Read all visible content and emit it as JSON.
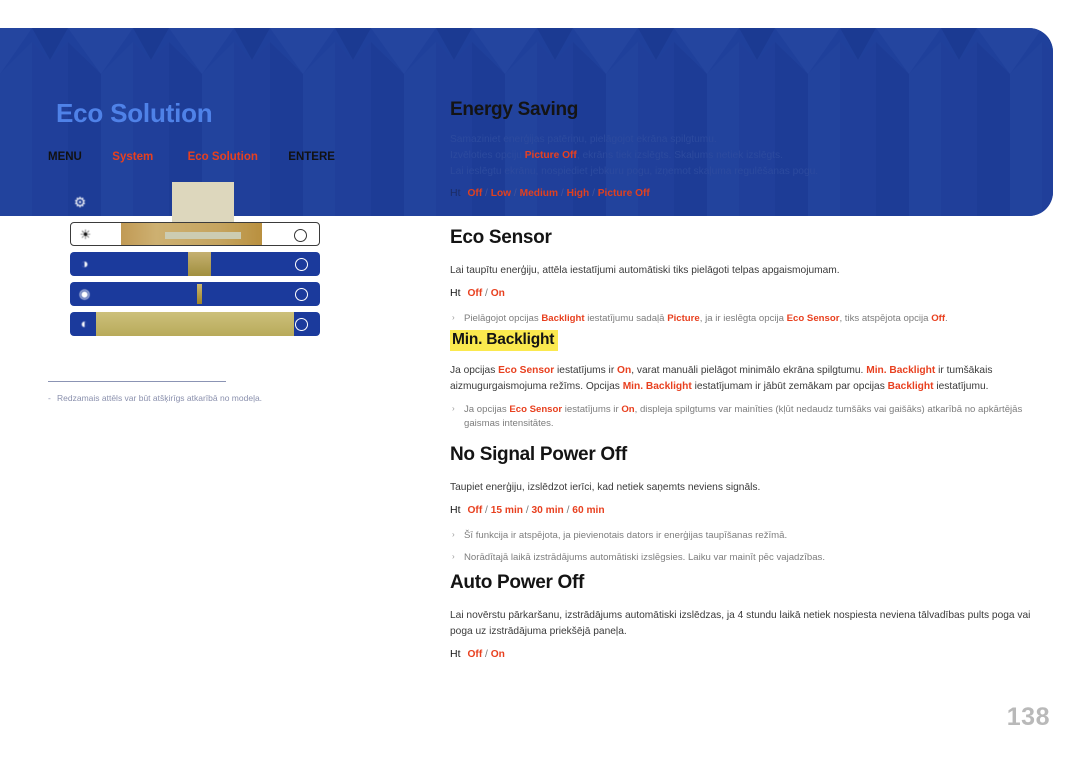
{
  "page": {
    "title": "Eco Solution",
    "number": "138",
    "accent_red": "#e8401f",
    "banner_blue": "#1f409b",
    "title_blue": "#4f82e8",
    "highlight_yellow": "#fbe94e"
  },
  "breadcrumb": {
    "menu": "MENU",
    "sep1": "m",
    "level1": "System",
    "sep2": "m",
    "level2": "Eco Solution",
    "sep3": "m",
    "enter": "ENTERE"
  },
  "osd": {
    "rows": [
      {
        "icon": "brightness-icon",
        "state": "selected",
        "toggle": "O"
      },
      {
        "icon": "contrast-icon",
        "state": "normal",
        "toggle": "O"
      },
      {
        "icon": "sharpness-icon",
        "state": "normal",
        "toggle": "O"
      },
      {
        "icon": "color-icon",
        "state": "normal",
        "toggle": "O"
      }
    ],
    "top_icon": "menu-icon"
  },
  "footnote": {
    "dash": "-",
    "text": "Redzamais attēls var būt atšķirīgs atkarībā no modeļa."
  },
  "sections": {
    "energy_saving": {
      "heading": "Energy Saving",
      "line1": "Samaziniet enerģijas patēriņu, pielāgojot ekrāna spilgtumu.",
      "line2_a": "Izvēloties opciju ",
      "line2_kw": "Picture Off",
      "line2_b": ", ekrāns tiek izslēgts. Skaļums netiek izslēgts.",
      "line3": "Lai ieslēgtu ekrānu, nospiediet jebkuru pogu, izņemot skaļuma regulēšanas pogu.",
      "opt_glyph": "Ht",
      "options": [
        "Off",
        "Low",
        "Medium",
        "High",
        "Picture Off"
      ]
    },
    "eco_sensor": {
      "heading": "Eco Sensor",
      "line1": "Lai taupītu enerģiju, attēla iestatījumi automātiski tiks pielāgoti telpas apgaismojumam.",
      "opt_glyph": "Ht",
      "options": [
        "Off",
        "On"
      ],
      "bullet_mark": "›",
      "bullet_a": "Pielāgojot opcijas ",
      "bullet_kw1": "Backlight",
      "bullet_b": " iestatījumu sadaļā ",
      "bullet_kw2": "Picture",
      "bullet_c": ", ja ir ieslēgta opcija ",
      "bullet_kw3": "Eco Sensor",
      "bullet_d": ", tiks atspējota opcija ",
      "bullet_kw4": "Off",
      "bullet_e": "."
    },
    "min_backlight": {
      "heading": "Min. Backlight",
      "p1_a": "Ja opcijas ",
      "p1_kw1": "Eco Sensor",
      "p1_b": " iestatījums ir ",
      "p1_kw2": "On",
      "p1_c": ", varat manuāli pielāgot minimālo ekrāna spilgtumu. ",
      "p1_kw3": "Min. Backlight",
      "p1_d": " ir tumšākais aizmugurgaismojuma režīms. Opcijas ",
      "p1_kw4": "Min. Backlight",
      "p1_e": " iestatījumam ir jābūt zemākam par opcijas ",
      "p1_kw5": "Backlight",
      "p1_f": " iestatījumu.",
      "bullet_mark": "›",
      "bullet_a": "Ja opcijas ",
      "bullet_kw1": "Eco Sensor",
      "bullet_b": " iestatījums ir ",
      "bullet_kw2": "On",
      "bullet_c": ", displeja spilgtums var mainīties (kļūt nedaudz tumšāks vai gaišāks) atkarībā no apkārtējās gaismas intensitātes."
    },
    "no_signal_power_off": {
      "heading": "No Signal Power Off",
      "line1": "Taupiet enerģiju, izslēdzot ierīci, kad netiek saņemts neviens signāls.",
      "opt_glyph": "Ht",
      "options": [
        "Off",
        "15 min",
        "30 min",
        "60 min"
      ],
      "bullet_mark": "›",
      "bullet1": "Šī funkcija ir atspējota, ja pievienotais dators ir enerģijas taupīšanas režīmā.",
      "bullet2": "Norādītajā laikā izstrādājums automātiski izslēgsies. Laiku var mainīt pēc vajadzības."
    },
    "auto_power_off": {
      "heading": "Auto Power Off",
      "line1": "Lai novērstu pārkaršanu, izstrādājums automātiski izslēdzas, ja 4 stundu laikā netiek nospiesta neviena tālvadības pults poga vai",
      "line2": "poga uz izstrādājuma priekšējā paneļa.",
      "opt_glyph": "Ht",
      "options": [
        "Off",
        "On"
      ]
    }
  }
}
